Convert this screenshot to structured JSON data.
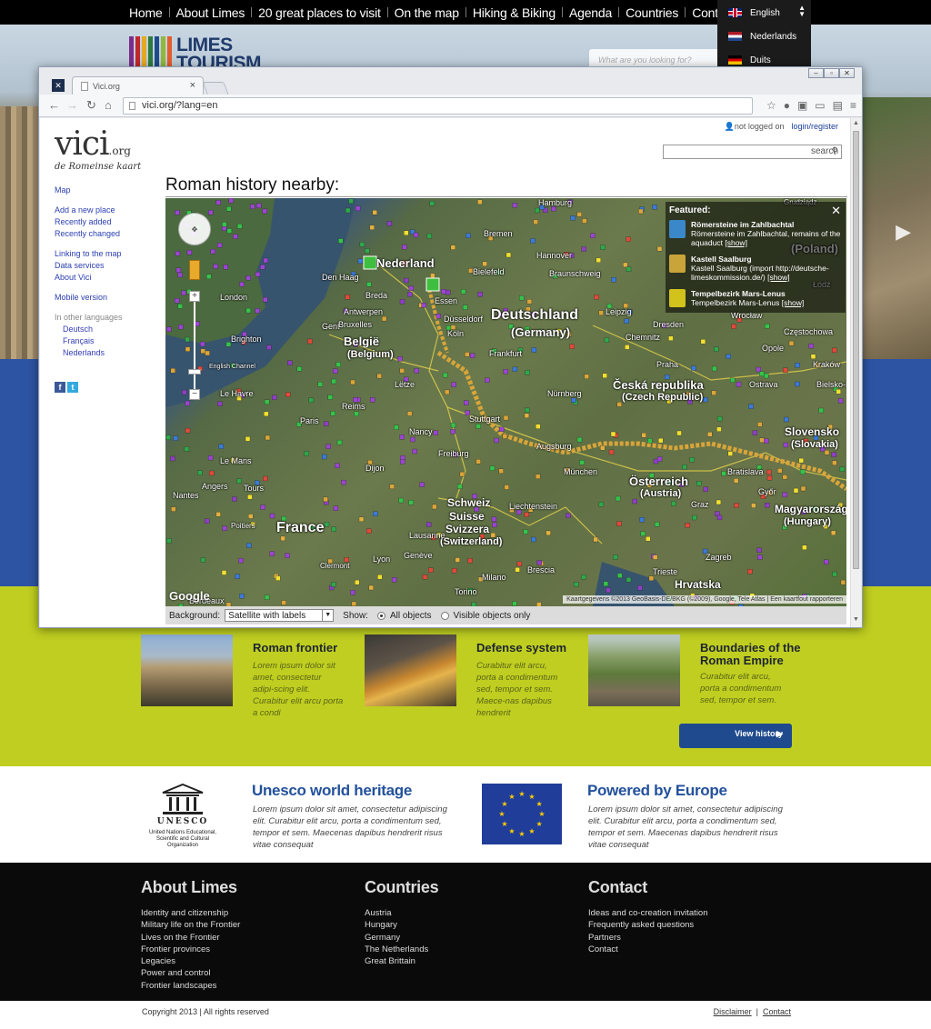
{
  "topnav": {
    "items": [
      "Home",
      "About Limes",
      "20 great places to visit",
      "On the map",
      "Hiking & Biking",
      "Agenda",
      "Countries",
      "Contact"
    ]
  },
  "language": {
    "options": [
      {
        "label": "English",
        "flag": "uk-flag-icon"
      },
      {
        "label": "Nederlands",
        "flag": "nl-flag-icon"
      },
      {
        "label": "Duits",
        "flag": "de-flag-icon"
      }
    ]
  },
  "logo": {
    "line1": "LIMES",
    "line2": "TOURISM",
    "colors": [
      "#7b2d8e",
      "#c1272d",
      "#e5a823",
      "#2d7a3e",
      "#1f4a8d",
      "#8fb83c",
      "#e35d2c"
    ]
  },
  "site_search": {
    "placeholder": "What are you looking for?"
  },
  "browser": {
    "tab_title": "Vici.org",
    "url": "vici.org/?lang=en",
    "window_controls": [
      "minimize-icon",
      "maximize-icon",
      "close-icon"
    ]
  },
  "vici": {
    "login_status": "not logged on",
    "login_link": "login/register",
    "logo_main": "vici",
    "logo_tld": ".org",
    "logo_sub": "de Romeinse kaart",
    "search_placeholder": "search",
    "nav": {
      "map": "Map",
      "add": "Add a new place",
      "recent_added": "Recently added",
      "recent_changed": "Recently changed",
      "linking": "Linking to the map",
      "data": "Data services",
      "about": "About Vici",
      "mobile": "Mobile version",
      "other_lang": "In other languages",
      "lang_de": "Deutsch",
      "lang_fr": "Français",
      "lang_nl": "Nederlands"
    },
    "heading": "Roman history nearby:",
    "map": {
      "labels": {
        "nederland": "Nederland",
        "deutschland": "Deutschland",
        "germany": "(Germany)",
        "belgie": "België",
        "belgium": "(Belgium)",
        "france": "France",
        "schweiz": "Schweiz",
        "suisse": "Suisse",
        "svizzera": "Svizzera",
        "switzerland": "(Switzerland)",
        "osterreich": "Österreich",
        "austria": "(Austria)",
        "cesko": "Česká republika",
        "czech": "(Czech Republic)",
        "slovensko": "Slovensko",
        "slovakia": "(Slovakia)",
        "magyarorszag": "Magyarország",
        "hungary": "(Hungary)",
        "poland": "(Poland)",
        "hrvatska": "Hrvatska",
        "hamburg": "Hamburg",
        "bremen": "Bremen",
        "hannover": "Hannover",
        "bielefeld": "Bielefeld",
        "braunschweig": "Braunschweig",
        "leipzig": "Leipzig",
        "dresden": "Dresden",
        "chemnitz": "Chemnitz",
        "praha": "Praha",
        "nurnberg": "Nürnberg",
        "wroclaw": "Wrocław",
        "opole": "Opole",
        "ostrava": "Ostrava",
        "krakow": "Kraków",
        "lodz": "Łódź",
        "czestochowa": "Częstochowa",
        "bielsko": "Bielsko-B",
        "grudziadz": "Grudziądz",
        "denhaag": "Den Haag",
        "breda": "Breda",
        "antwerpen": "Antwerpen",
        "gent": "Gent",
        "essen": "Essen",
        "dusseldorf": "Düsseldorf",
        "koln": "Köln",
        "frankfurt": "Frankfurt",
        "reims": "Reims",
        "paris": "Paris",
        "lehavre": "Le Havre",
        "lemans": "Le Mans",
        "angers": "Angers",
        "tours": "Tours",
        "nantes": "Nantes",
        "dijon": "Dijon",
        "lyon": "Lyon",
        "geneve": "Genève",
        "lausanne": "Lausanne",
        "milano": "Milano",
        "brescia": "Brescia",
        "torino": "Torino",
        "bratislava": "Bratislava",
        "gyor": "Győr",
        "graz": "Graz",
        "zagreb": "Zagreb",
        "trieste": "Trieste",
        "liechtenstein": "Liechtenstein",
        "munchen": "München",
        "channel": "English Channel",
        "london": "London",
        "brighton": "Brighton",
        "poitiers": "Poitiers",
        "bordeaux": "Bordeaux",
        "clermont": "Clermont",
        "nancy": "Nancy",
        "augsburg": "Augsburg",
        "stuttgart": "Stuttgart",
        "freiburg": "Freiburg",
        "bruxelles": "Bruxelles",
        "letzebuerg": "Lëtze"
      },
      "featured": {
        "heading": "Featured:",
        "items": [
          {
            "title": "Römersteine im Zahlbachtal",
            "desc": "Römersteine im Zahlbachtal, remains of the aquaduct",
            "link": "[show]",
            "color": "#3a87c9"
          },
          {
            "title": "Kastell Saalburg",
            "desc": "Kastell Saalburg (import http://deutsche-limeskommission.de/)",
            "link": "[show]",
            "color": "#c9a43a"
          },
          {
            "title": "Tempelbezirk Mars-Lenus",
            "desc": "Tempelbezirk Mars-Lenus",
            "link": "[show]",
            "color": "#d1c21c"
          }
        ]
      },
      "google": "Google",
      "attribution": "Kaartgegevens ©2013 GeoBasis-DE/BKG (©2009), Google, Tele Atlas",
      "report": "Een kaartfout rapporteren"
    },
    "controls": {
      "background_label": "Background:",
      "background_value": "Satellite with labels",
      "show_label": "Show:",
      "opt_all": "All objects",
      "opt_visible": "Visible objects only"
    }
  },
  "cards": [
    {
      "title": "Roman frontier",
      "text": "Lorem ipsum dolor sit amet, consectetur adipi-scing elit. Curabitur elit arcu porta a condi"
    },
    {
      "title": "Defense system",
      "text": "Curabitur elit arcu, porta a condimentum sed, tempor et sem. Maece-nas dapibus hendrerit"
    },
    {
      "title": "Boundaries of the Roman Empire",
      "text": "Curabitur elit arcu, porta a condimentum sed, tempor et sem."
    }
  ],
  "view_history": "View history",
  "partners": {
    "unesco_word": "UNESCO",
    "unesco_caption": "United Nations Educational, Scientific and Cultural Organization",
    "unesco_title": "Unesco world heritage",
    "unesco_text": "Lorem ipsum dolor sit amet, consectetur adipiscing elit. Curabitur elit arcu, porta a condimentum sed, tempor et sem. Maecenas dapibus hendrerit risus vitae consequat",
    "europe_title": "Powered by Europe",
    "europe_text": "Lorem ipsum dolor sit amet, consectetur adipiscing elit. Curabitur elit arcu, porta a condimentum sed, tempor et sem. Maecenas dapibus hendrerit risus vitae consequat"
  },
  "footer": {
    "about": {
      "title": "About Limes",
      "links": [
        "Identity and citizenship",
        "Military life on the Frontier",
        "Lives on the Frontier",
        "Frontier provinces",
        "Legacies",
        "Power and control",
        "Frontier landscapes"
      ]
    },
    "countries": {
      "title": "Countries",
      "links": [
        "Austria",
        "Hungary",
        "Germany",
        "The Netherlands",
        "Great Brittain"
      ]
    },
    "contact": {
      "title": "Contact",
      "links": [
        "Ideas and co-creation invitation",
        "Frequently asked questions",
        "Partners",
        "Contact"
      ]
    },
    "copyright": "Copyright 2013 |  All rights reserved",
    "disclaimer": "Disclaimer",
    "contact_link": "Contact"
  }
}
